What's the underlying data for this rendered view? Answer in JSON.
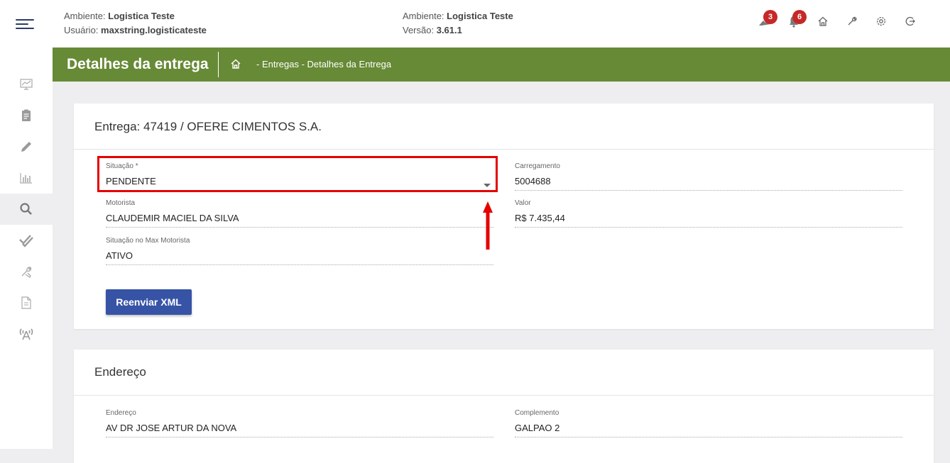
{
  "header": {
    "env_label_1": "Ambiente:",
    "env_value_1": "Logistica Teste",
    "user_label": "Usuário:",
    "user_value": "maxstring.logisticateste",
    "env_label_2": "Ambiente:",
    "env_value_2": "Logistica Teste",
    "version_label": "Versão:",
    "version_value": "3.61.1",
    "icons": [
      {
        "name": "truck-notification-icon",
        "badge": "3"
      },
      {
        "name": "bell-icon",
        "badge": "6"
      },
      {
        "name": "home-icon"
      },
      {
        "name": "wrench-icon"
      },
      {
        "name": "gear-icon"
      },
      {
        "name": "logout-icon"
      }
    ],
    "badge_color": "#c62828"
  },
  "sidebar": {
    "items": [
      {
        "icon": "chart-presentation-icon"
      },
      {
        "icon": "clipboard-icon"
      },
      {
        "icon": "pencil-icon"
      },
      {
        "icon": "bar-chart-icon"
      },
      {
        "icon": "search-icon",
        "active": true
      },
      {
        "icon": "double-check-icon"
      },
      {
        "icon": "tools-icon"
      },
      {
        "icon": "document-icon"
      },
      {
        "icon": "antenna-icon"
      }
    ]
  },
  "titlebar": {
    "title": "Detalhes da entrega",
    "breadcrumb": "- Entregas - Detalhes da Entrega",
    "color": "#678a36"
  },
  "delivery": {
    "heading": "Entrega: 47419 / OFERE CIMENTOS S.A.",
    "situacao_label": "Situação *",
    "situacao_value": "PENDENTE",
    "carregamento_label": "Carregamento",
    "carregamento_value": "5004688",
    "motorista_label": "Motorista",
    "motorista_value": "CLAUDEMIR MACIEL DA SILVA",
    "valor_label": "Valor",
    "valor_value": "R$ 7.435,44",
    "situacao_max_label": "Situação no Max Motorista",
    "situacao_max_value": "ATIVO",
    "resend_button": "Reenviar XML",
    "button_color": "#3653a6"
  },
  "address": {
    "heading": "Endereço",
    "endereco_label": "Endereço",
    "endereco_value": "AV DR JOSE ARTUR DA NOVA",
    "complemento_label": "Complemento",
    "complemento_value": "GALPAO 2"
  },
  "annotation": {
    "highlight_color": "#e50000"
  }
}
